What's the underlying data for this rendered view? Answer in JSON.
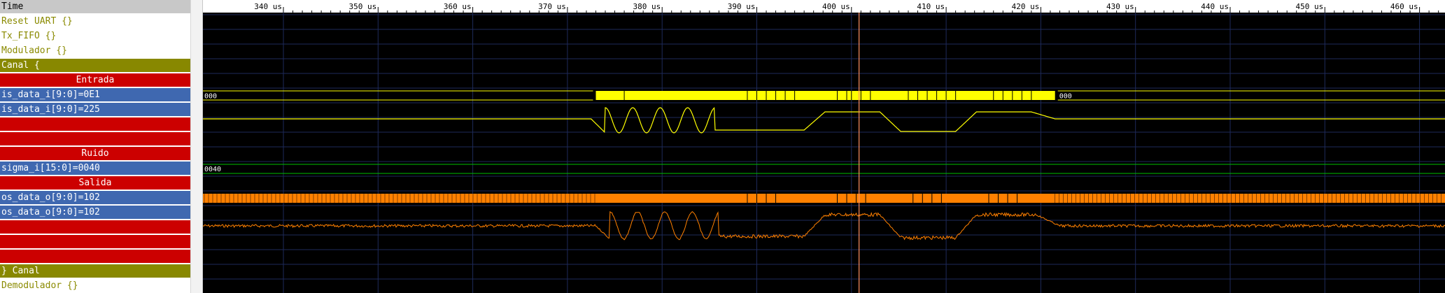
{
  "time_header": "Time",
  "rows": [
    {
      "type": "hdr",
      "label": "Time"
    },
    {
      "type": "grp",
      "label": "Reset UART {}"
    },
    {
      "type": "grp",
      "label": "Tx_FIFO {}"
    },
    {
      "type": "grp",
      "label": "Modulador {}"
    },
    {
      "type": "grpopen",
      "label": "Canal {"
    },
    {
      "type": "sep",
      "label": "Entrada"
    },
    {
      "type": "sig",
      "label": "is_data_i[9:0]=0E1"
    },
    {
      "type": "sig",
      "label": "is_data_i[9:0]=225"
    },
    {
      "type": "blank",
      "label": ""
    },
    {
      "type": "blank",
      "label": ""
    },
    {
      "type": "sep",
      "label": "Ruido"
    },
    {
      "type": "sig",
      "label": " sigma_i[15:0]=0040"
    },
    {
      "type": "sep",
      "label": "Salida"
    },
    {
      "type": "sig",
      "label": "os_data_o[9:0]=102"
    },
    {
      "type": "sig",
      "label": "os_data_o[9:0]=102"
    },
    {
      "type": "blank",
      "label": ""
    },
    {
      "type": "blank",
      "label": ""
    },
    {
      "type": "blank",
      "label": ""
    },
    {
      "type": "grpopen",
      "label": "} Canal"
    },
    {
      "type": "grp",
      "label": "Demodulador {}"
    }
  ],
  "time_ticks": [
    "340 us",
    "350 us",
    "360 us",
    "370 us",
    "380 us",
    "390 us",
    "400 us",
    "410 us",
    "420 us",
    "430 us",
    "440 us",
    "450 us",
    "460 us"
  ],
  "bus_values": {
    "is_data_left": "000",
    "is_data_right": "000",
    "sigma": "0040"
  },
  "colors": {
    "wave_bg": "#000000",
    "grid": "#1e2a5a",
    "yellow": "#ffff00",
    "orange": "#ff8000",
    "green": "#00c000",
    "cursor": "#ff9060"
  },
  "cursor_time_us": 400.8
}
